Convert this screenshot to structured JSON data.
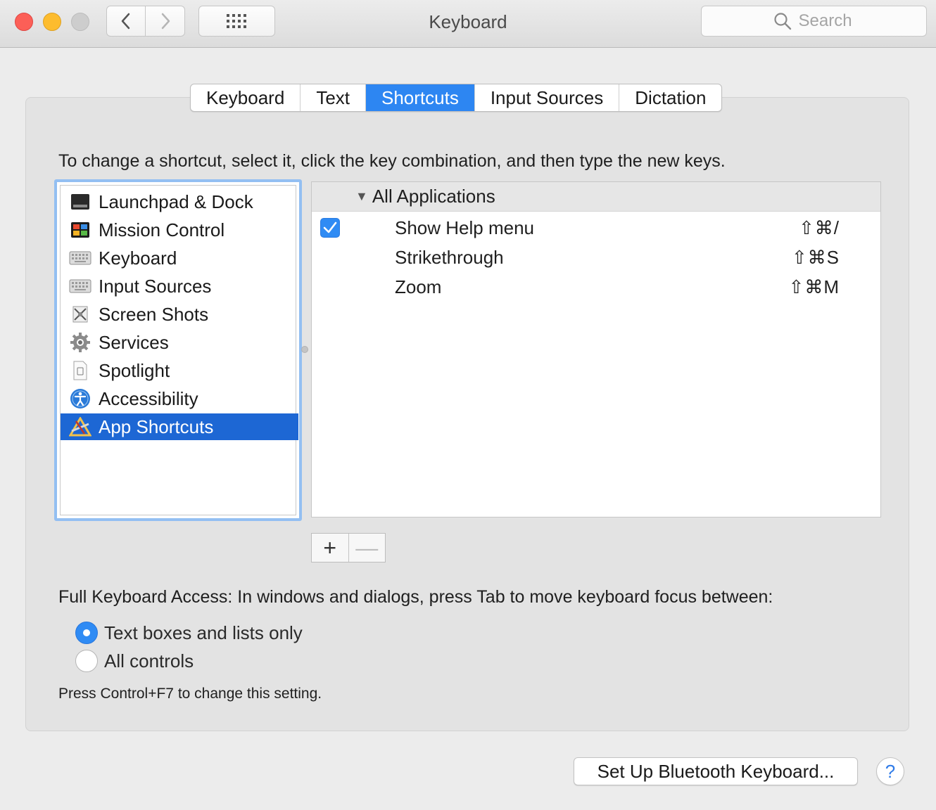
{
  "window": {
    "title": "Keyboard"
  },
  "toolbar": {
    "search_placeholder": "Search"
  },
  "tabs": [
    {
      "label": "Keyboard",
      "active": false
    },
    {
      "label": "Text",
      "active": false
    },
    {
      "label": "Shortcuts",
      "active": true
    },
    {
      "label": "Input Sources",
      "active": false
    },
    {
      "label": "Dictation",
      "active": false
    }
  ],
  "instruction": "To change a shortcut, select it, click the key combination, and then type the new keys.",
  "categories": [
    {
      "label": "Launchpad & Dock",
      "icon": "launchpad-dock-icon"
    },
    {
      "label": "Mission Control",
      "icon": "mission-control-icon"
    },
    {
      "label": "Keyboard",
      "icon": "keyboard-icon"
    },
    {
      "label": "Input Sources",
      "icon": "keyboard-icon"
    },
    {
      "label": "Screen Shots",
      "icon": "screenshot-icon"
    },
    {
      "label": "Services",
      "icon": "gear-icon"
    },
    {
      "label": "Spotlight",
      "icon": "document-icon"
    },
    {
      "label": "Accessibility",
      "icon": "accessibility-icon"
    },
    {
      "label": "App Shortcuts",
      "icon": "app-shortcuts-icon",
      "selected": true
    }
  ],
  "shortcuts": {
    "group": "All Applications",
    "rows": [
      {
        "label": "Show Help menu",
        "keys": "⇧⌘/",
        "checked": true
      },
      {
        "label": "Strikethrough",
        "keys": "⇧⌘S"
      },
      {
        "label": "Zoom",
        "keys": "⇧⌘M"
      }
    ],
    "add_label": "+",
    "remove_label": "—"
  },
  "full_keyboard_access": {
    "label": "Full Keyboard Access: In windows and dialogs, press Tab to move keyboard focus between:",
    "options": [
      {
        "label": "Text boxes and lists only",
        "selected": true
      },
      {
        "label": "All controls",
        "selected": false
      }
    ],
    "hint": "Press Control+F7 to change this setting."
  },
  "footer": {
    "bluetooth_button": "Set Up Bluetooth Keyboard...",
    "help_label": "?"
  },
  "colors": {
    "accent": "#2d86f2",
    "selection": "#1d67d4"
  }
}
